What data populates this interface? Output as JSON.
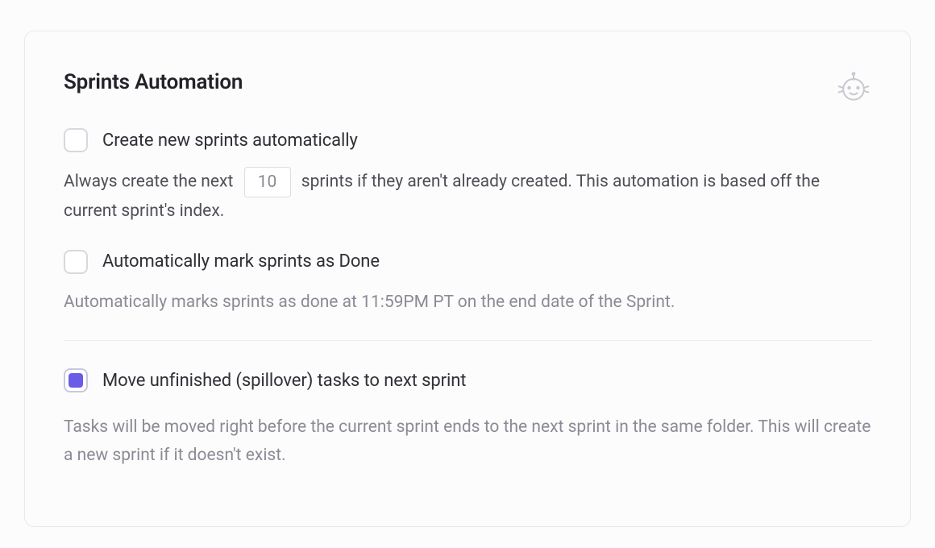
{
  "panel": {
    "title": "Sprints Automation"
  },
  "options": {
    "create_auto": {
      "checked": false,
      "label": "Create new sprints automatically",
      "desc_before": "Always create the next",
      "count": "10",
      "desc_after": "sprints if they aren't already created. This automation is based off the current sprint's index."
    },
    "mark_done": {
      "checked": false,
      "label": "Automatically mark sprints as Done",
      "desc": "Automatically marks sprints as done at 11:59PM PT on the end date of the Sprint."
    },
    "spillover": {
      "checked": true,
      "label": "Move unfinished (spillover) tasks to next sprint",
      "desc": "Tasks will be moved right before the current sprint ends to the next sprint in the same folder. This will create a new sprint if it doesn't exist."
    }
  }
}
